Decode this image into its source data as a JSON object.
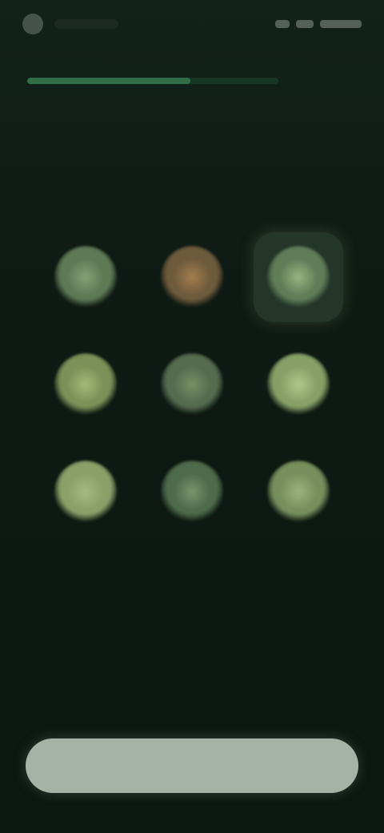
{
  "progress": {
    "fraction": 0.65,
    "track_color": "#173624",
    "fill_color": "#2f6e46"
  },
  "headline": {
    "text": ""
  },
  "options": [
    {
      "icon": "green-orb-icon",
      "color": "#5e7a55",
      "core": "#86a67a",
      "selected": false
    },
    {
      "icon": "amber-orb-icon",
      "color": "#6e5a3c",
      "core": "#a98250",
      "selected": false
    },
    {
      "icon": "leaf-orb-icon",
      "color": "#5f7e58",
      "core": "#9cbb86",
      "selected": true
    },
    {
      "icon": "olive-orb-icon",
      "color": "#7d9058",
      "core": "#a9bf7a",
      "selected": false
    },
    {
      "icon": "moss-orb-icon",
      "color": "#556c4e",
      "core": "#7a9467",
      "selected": false
    },
    {
      "icon": "lime-orb-icon",
      "color": "#86a066",
      "core": "#b6cc8c",
      "selected": false
    },
    {
      "icon": "sage-orb-icon",
      "color": "#8aa068",
      "core": "#a9bd83",
      "selected": false
    },
    {
      "icon": "fern-orb-icon",
      "color": "#4d6a4a",
      "core": "#7c9a70",
      "selected": false
    },
    {
      "icon": "pale-green-orb-icon",
      "color": "#768f5c",
      "core": "#a0b880",
      "selected": false
    }
  ],
  "continue_button": {
    "label": "",
    "background": "#a5b3a7"
  }
}
